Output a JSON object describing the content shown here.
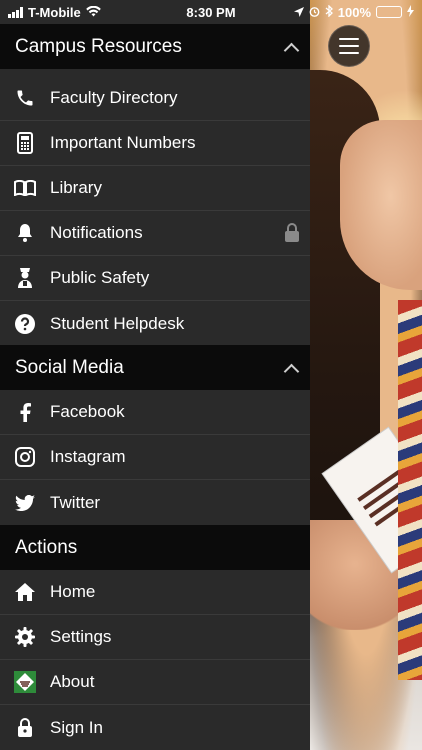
{
  "status_bar": {
    "carrier": "T-Mobile",
    "time": "8:30 PM",
    "battery": "100%"
  },
  "sections": [
    {
      "title": "Campus Resources",
      "items": [
        {
          "label": "Faculty Directory",
          "icon": "phone-icon"
        },
        {
          "label": "Important Numbers",
          "icon": "calculator-icon"
        },
        {
          "label": "Library",
          "icon": "book-icon"
        },
        {
          "label": "Notifications",
          "icon": "bell-icon",
          "locked": true
        },
        {
          "label": "Public Safety",
          "icon": "officer-icon"
        },
        {
          "label": "Student Helpdesk",
          "icon": "question-icon"
        }
      ]
    },
    {
      "title": "Social Media",
      "items": [
        {
          "label": "Facebook",
          "icon": "facebook-icon"
        },
        {
          "label": "Instagram",
          "icon": "instagram-icon"
        },
        {
          "label": "Twitter",
          "icon": "twitter-icon"
        }
      ]
    },
    {
      "title": "Actions",
      "items": [
        {
          "label": "Home",
          "icon": "home-icon"
        },
        {
          "label": "Settings",
          "icon": "gear-icon"
        },
        {
          "label": "About",
          "icon": "diamond-logo-icon"
        },
        {
          "label": "Sign In",
          "icon": "lock-icon"
        }
      ]
    }
  ],
  "colors": {
    "drawer_bg": "#2a2a2a",
    "header_bg": "#0b0b0b",
    "battery_green": "#4cd964",
    "about_icon_green": "#2e8b3a"
  }
}
